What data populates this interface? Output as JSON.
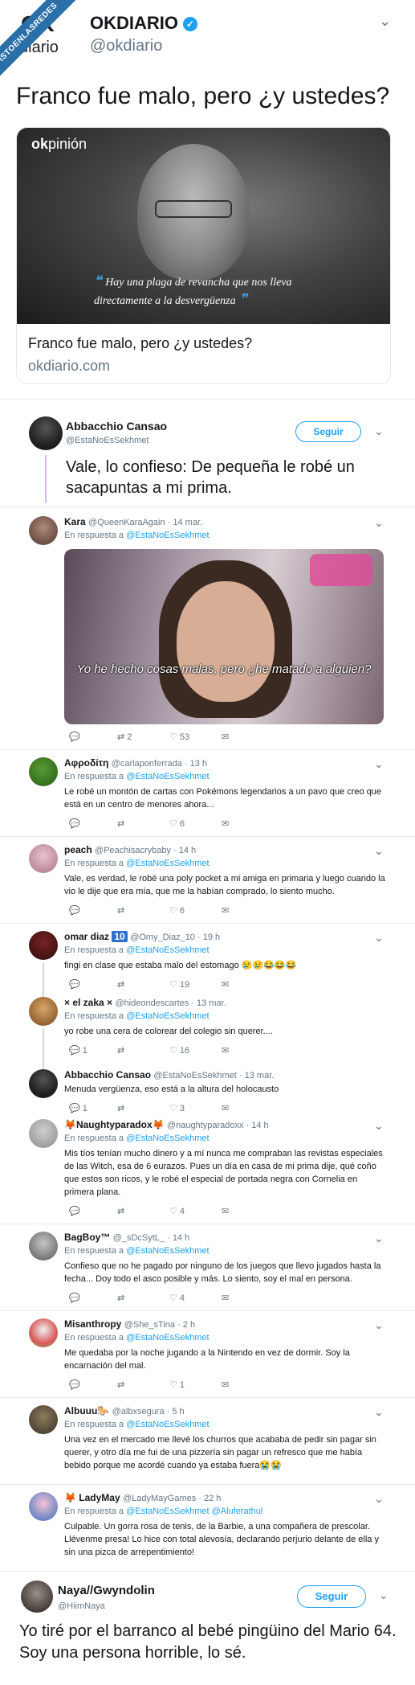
{
  "watermark": "VISTOENLASREDES",
  "header": {
    "logo_ok": "OK",
    "logo_rest": "diario",
    "name": "OKDIARIO",
    "handle": "@okdiario",
    "text": "Franco fue malo, pero ¿y ustedes?"
  },
  "card": {
    "brand_ok": "ok",
    "brand_rest": "pinión",
    "quote": "Hay una plaga de revancha que nos lleva directamente a la desvergüenza",
    "title": "Franco fue malo, pero ¿y ustedes?",
    "url": "okdiario.com"
  },
  "tweet1": {
    "name": "Abbacchio Cansao",
    "handle": "@EstaNoEsSekhmet",
    "follow": "Seguir",
    "text": "Vale, lo confieso: De pequeña le robé un sacapuntas a mi prima."
  },
  "replies": [
    {
      "name": "Kara",
      "handle": "@QueenKaraAgain · 14 mar.",
      "reply_to": "En respuesta a",
      "reply_handle": "@EstaNoEsSekhmet",
      "text": "",
      "gif_sub": "Yo he hecho cosas malas, pero ¿he matado a alguien?",
      "rt": "2",
      "likes": "53"
    },
    {
      "name": "Αφροδίτη",
      "handle": "@carlaponferrada · 13 h",
      "reply_to": "En respuesta a",
      "reply_handle": "@EstaNoEsSekhmet",
      "text": "Le robé un montón de cartas con Pokémons legendarios a un pavo que creo que está en un centro de menores ahora...",
      "likes": "6"
    },
    {
      "name": "peach",
      "handle": "@Peachisacrybaby · 14 h",
      "reply_to": "En respuesta a",
      "reply_handle": "@EstaNoEsSekhmet",
      "text": "Vale, es verdad, le robé una poly pocket a mi amiga en primaria y luego cuando la vio le dije que era mía, que me la habían comprado, lo siento mucho.",
      "likes": "6"
    },
    {
      "name": "omar diaz",
      "badge": "10",
      "handle": "@Omy_Diaz_10 · 19 h",
      "reply_to": "En respuesta a",
      "reply_handle": "@EstaNoEsSekhmet",
      "text": "fingi en clase que estaba malo del estomago 😢😢😂😂😂",
      "likes": "19"
    },
    {
      "name": "× el zaka ×",
      "handle": "@hideondescartes · 13 mar.",
      "reply_to": "En respuesta a",
      "reply_handle": "@EstaNoEsSekhmet",
      "text": "yo robe una cera de colorear del colegio sin querer....",
      "replies": "1",
      "likes": "16"
    },
    {
      "name": "Abbacchio Cansao",
      "handle": "@EstaNoEsSekhmet · 13 mar.",
      "text": "Menuda vergüenza, eso está a la altura del holocausto",
      "replies": "1",
      "likes": "3"
    },
    {
      "name": "🦊Naughtyparadox🦊",
      "handle": "@naughtyparadoxx · 14 h",
      "reply_to": "En respuesta a",
      "reply_handle": "@EstaNoEsSekhmet",
      "text": "Mis tíos tenían mucho dinero y a mí nunca me compraban las revistas especiales de las Witch, esa de 6 eurazos. Pues un día en casa de mi prima dije, qué coño que estos son ricos, y le robé el especial de portada negra con Cornelia en primera plana.",
      "likes": "4"
    },
    {
      "name": "BagBoy™",
      "handle": "@_sDcSytL_ · 14 h",
      "reply_to": "En respuesta a",
      "reply_handle": "@EstaNoEsSekhmet",
      "text": "Confieso que no he pagado por ninguno de los juegos que llevo jugados hasta la fecha... Doy todo el asco posible y más. Lo siento, soy el mal en persona.",
      "likes": "4"
    },
    {
      "name": "Misanthropy",
      "handle": "@She_sTina · 2 h",
      "reply_to": "En respuesta a",
      "reply_handle": "@EstaNoEsSekhmet",
      "text": "Me quedaba por la noche jugando a la Nintendo en vez de dormir. Soy la encarnación del mal.",
      "likes": "1"
    },
    {
      "name": "Albuuu🐎",
      "handle": "@albxsegura · 5 h",
      "reply_to": "En respuesta a",
      "reply_handle": "@EstaNoEsSekhmet",
      "text": "Una vez en el mercado me llevé los churros que acababa de pedir sin pagar sin querer, y otro día me fui de una pizzería sin pagar un refresco que me había bebido porque me acordé cuando ya estaba fuera😭😭"
    },
    {
      "name": "🦊 LadyMay",
      "handle": "@LadyMayGames · 22 h",
      "reply_to": "En respuesta a",
      "reply_handle": "@EstaNoEsSekhmet @Aluferathul",
      "text": "Culpable. Un gorra rosa de tenis, de la Barbie, a una compañera de prescolar. Llévenme presa! Lo hice con total alevosía, declarando perjurio delante de ella y sin una pizca de arrepentimiento!"
    }
  ],
  "tweet2": {
    "name": "Naya//Gwyndolin",
    "handle": "@HiimNaya",
    "follow": "Seguir",
    "text": "Yo tiré por el barranco al bebé pingüino del Mario 64. Soy una persona horrible, lo sé."
  },
  "icons": [
    "chevron-down-icon",
    "verified-icon",
    "reply-icon",
    "retweet-icon",
    "heart-icon",
    "dm-icon"
  ],
  "colors": {
    "link": "#1da1f2",
    "muted": "#657786",
    "watermark": "#2b6fa8"
  }
}
